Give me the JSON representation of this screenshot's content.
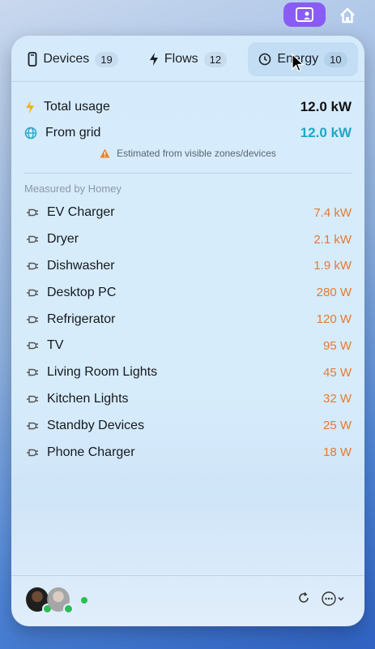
{
  "colors": {
    "accent_orange": "#e27a35",
    "grid_teal": "#1fa7c7",
    "bolt_yellow": "#f3b21a",
    "menubar_app": "#8a5cf6"
  },
  "tabs": [
    {
      "label": "Devices",
      "count": "19",
      "icon": "phone-icon",
      "active": false
    },
    {
      "label": "Flows",
      "count": "12",
      "icon": "bolt-icon",
      "active": false
    },
    {
      "label": "Energy",
      "count": "10",
      "icon": "clock-icon",
      "active": true
    }
  ],
  "summary": {
    "total_label": "Total usage",
    "total_value": "12.0 kW",
    "grid_label": "From grid",
    "grid_value": "12.0 kW",
    "warning": "Estimated from visible zones/devices"
  },
  "section_label": "Measured by Homey",
  "devices": [
    {
      "name": "EV Charger",
      "power": "7.4 kW"
    },
    {
      "name": "Dryer",
      "power": "2.1 kW"
    },
    {
      "name": "Dishwasher",
      "power": "1.9 kW"
    },
    {
      "name": "Desktop PC",
      "power": "280 W"
    },
    {
      "name": "Refrigerator",
      "power": "120 W"
    },
    {
      "name": "TV",
      "power": "95 W"
    },
    {
      "name": "Living Room Lights",
      "power": "45 W"
    },
    {
      "name": "Kitchen Lights",
      "power": "32 W"
    },
    {
      "name": "Standby Devices",
      "power": "25 W"
    },
    {
      "name": "Phone Charger",
      "power": "18 W"
    }
  ]
}
